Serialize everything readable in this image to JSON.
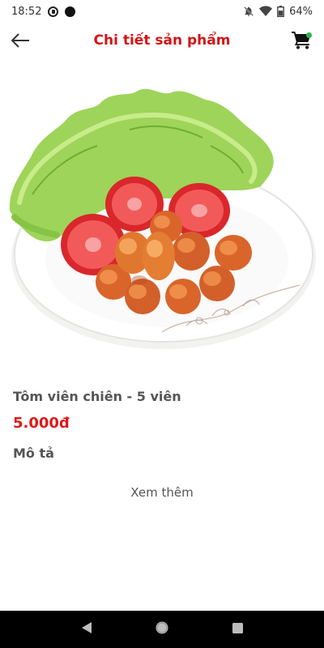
{
  "status_bar": {
    "time": "18:52",
    "battery": "64%",
    "icons": [
      "p-circle-icon",
      "dot-icon",
      "bell-off-icon",
      "wifi-icon",
      "battery-icon"
    ]
  },
  "app_bar": {
    "title": "Chi tiết sản phẩm",
    "back_icon": "arrow-left-icon",
    "cart_icon": "shopping-cart-icon",
    "cart_badge_color": "#2db24a"
  },
  "product": {
    "name": "Tôm viên chiên - 5 viên",
    "price": "5.000đ",
    "description_label": "Mô tả",
    "see_more_label": "Xem thêm"
  },
  "colors": {
    "title": "#d41414",
    "price": "#e0181a",
    "text": "#555555"
  },
  "nav_bar": {
    "icons": [
      "back-triangle-icon",
      "home-circle-icon",
      "recents-square-icon"
    ]
  }
}
